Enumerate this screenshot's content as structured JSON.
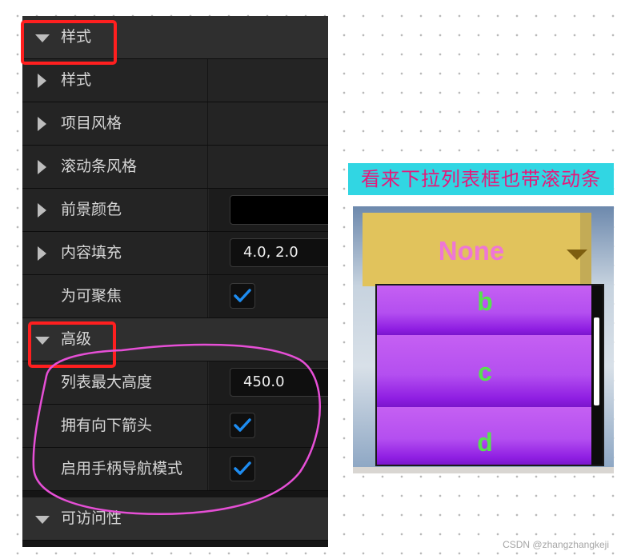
{
  "details_panel": {
    "rows": [
      {
        "kind": "section",
        "expanded": true,
        "label": "样式"
      },
      {
        "kind": "prop",
        "arrow": "right",
        "label": "样式"
      },
      {
        "kind": "prop",
        "arrow": "right",
        "label": "项目风格"
      },
      {
        "kind": "prop",
        "arrow": "right",
        "label": "滚动条风格"
      },
      {
        "kind": "prop",
        "arrow": "right",
        "label": "前景颜色",
        "color": "#000000"
      },
      {
        "kind": "prop",
        "arrow": "right",
        "label": "内容填充",
        "value": "4.0, 2.0"
      },
      {
        "kind": "prop",
        "label": "为可聚焦",
        "checked": true
      },
      {
        "kind": "section",
        "expanded": true,
        "label": "高级"
      },
      {
        "kind": "prop",
        "label": "列表最大高度",
        "value": "450.0"
      },
      {
        "kind": "prop",
        "label": "拥有向下箭头",
        "checked": true
      },
      {
        "kind": "prop",
        "label": "启用手柄导航模式",
        "checked": true
      },
      {
        "kind": "section",
        "expanded": true,
        "label": "可访问性"
      }
    ]
  },
  "annotation": {
    "text": "看来下拉列表框也带滚动条",
    "background": "#31d6e3",
    "color": "#e6187a",
    "highlight_box_color": "#ff1f1f",
    "circle_color": "#e64fd6"
  },
  "preview": {
    "combo_label": "None",
    "items": [
      "b",
      "c",
      "d"
    ]
  },
  "watermark": "CSDN @zhangzhangkeji",
  "colors": {
    "panel_bg": "#151515",
    "check_color": "#1e8cf0",
    "item_text": "#57e24e",
    "combo_text": "#ee77d4",
    "combo_bg": "#e1c35c"
  }
}
